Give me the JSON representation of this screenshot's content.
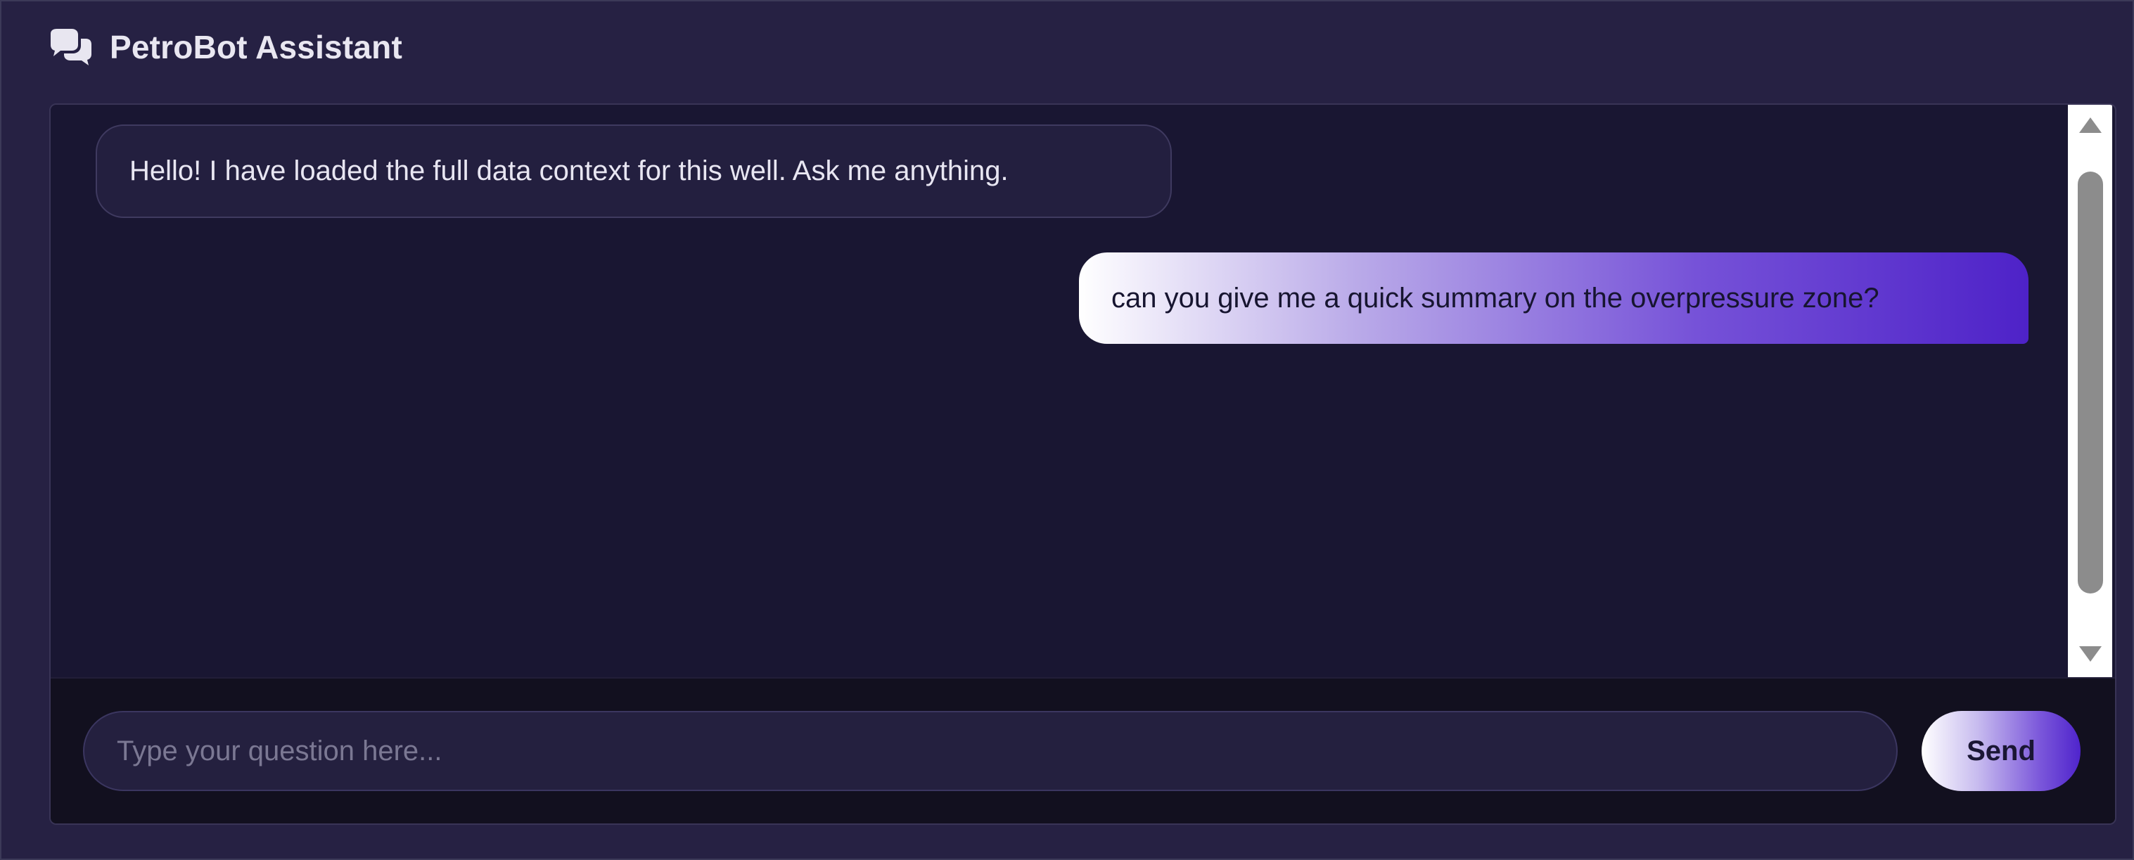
{
  "header": {
    "title": "PetroBot Assistant",
    "icon": "comments-icon"
  },
  "messages": [
    {
      "role": "bot",
      "text": "Hello! I have loaded the full data context for this well. Ask me anything."
    },
    {
      "role": "user",
      "text": "can you give me a quick summary on the overpressure zone?"
    }
  ],
  "input": {
    "placeholder": "Type your question here...",
    "value": ""
  },
  "send_button": {
    "label": "Send"
  },
  "colors": {
    "background": "#262143",
    "panel": "#191632",
    "bot_bubble": "#231f3f",
    "user_gradient_start": "#ffffff",
    "user_gradient_end": "#4e22c8",
    "text": "#e8e6f2"
  }
}
